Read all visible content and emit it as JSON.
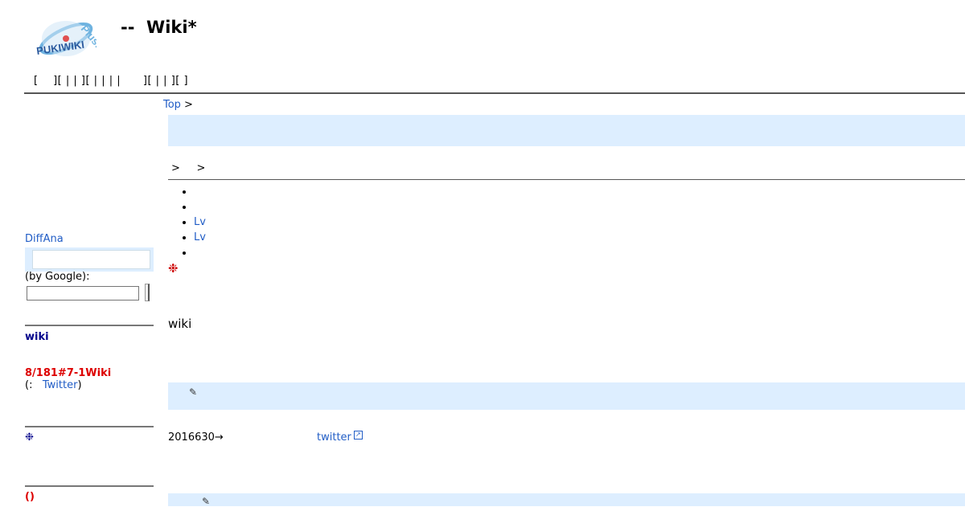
{
  "header": {
    "logo_text": "PUKIWIKI",
    "logo_plus": "Plus!",
    "title": "--  Wiki*",
    "nav_text": "[    ][ | | ][ | | | |      ][ | | ][ ]"
  },
  "breadcrumb": {
    "top_label": "Top",
    "separator": ">"
  },
  "sub_nav": ">     >",
  "bullets": [
    {
      "label": "",
      "link": false
    },
    {
      "label": "",
      "link": false
    },
    {
      "label": "Lv",
      "link": true
    },
    {
      "label": "Lv",
      "link": true
    },
    {
      "label": "",
      "link": false
    }
  ],
  "note_mark": "❉",
  "wiki_heading": "wiki",
  "edit_icon": "✎",
  "update": {
    "text": "2016630→",
    "twitter_label": "twitter"
  },
  "sidebar": {
    "diffana_label": "DiffAna",
    "google_label": "(by Google):",
    "search_placeholder": "",
    "wiki_label": "wiki",
    "notice": "8/181#7-1Wiki",
    "twitter_prefix": "(:   ",
    "twitter_label": "Twitter",
    "twitter_suffix": ")",
    "mark": "❉",
    "paren": "()"
  },
  "colors": {
    "link": "#215dc6",
    "box": "#ddeeff",
    "red": "#cc0000",
    "navy": "#00008b"
  }
}
